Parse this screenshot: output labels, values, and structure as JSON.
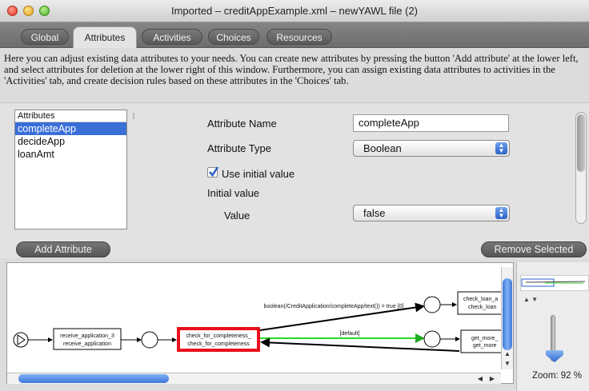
{
  "window": {
    "title": "Imported – creditAppExample.xml – newYAWL file (2)"
  },
  "tabs": [
    {
      "label": "Global",
      "active": false
    },
    {
      "label": "Attributes",
      "active": true
    },
    {
      "label": "Activities",
      "active": false
    },
    {
      "label": "Choices",
      "active": false
    },
    {
      "label": "Resources",
      "active": false
    }
  ],
  "description": "Here you can adjust existing data attributes to your needs. You can create new attributes by pressing the button 'Add attribute' at the lower left, and select attributes for deletion at the lower right of this window.  Furthermore, you can assign existing data attributes to activities in the 'Activities' tab, and create decision rules based on these attributes in the 'Choices' tab.",
  "attribute_list": {
    "header": "Attributes",
    "items": [
      "completeApp",
      "decideApp",
      "loanAmt"
    ],
    "selected": "completeApp"
  },
  "form": {
    "name_label": "Attribute Name",
    "name_value": "completeApp",
    "type_label": "Attribute Type",
    "type_value": "Boolean",
    "use_initial_label": "Use initial value",
    "use_initial_checked": true,
    "initial_value_label": "Initial value",
    "value_label": "Value",
    "value_value": "false"
  },
  "buttons": {
    "add": "Add Attribute",
    "remove": "Remove Selected"
  },
  "graph": {
    "nodes": {
      "receive": [
        "receive_application_3",
        "receive_application"
      ],
      "check_completeness": [
        "check_for_completeness_",
        "check_for_completeness"
      ],
      "check_loan": [
        "check_loan_a",
        "check_loan"
      ],
      "get_more": [
        "get_more_",
        "get_more"
      ]
    },
    "edge_labels": {
      "condition": "boolean(/CreditApplication/completeApp/text()) = true [0]",
      "default": "[default]"
    }
  },
  "zoom": {
    "label": "Zoom: 92 %",
    "level_percent": 92
  },
  "colors": {
    "selection": "#3a6fd8",
    "selected_task_border": "#e8101a",
    "default_flow": "#22dd22",
    "scroll_thumb": "#3d77d8"
  }
}
